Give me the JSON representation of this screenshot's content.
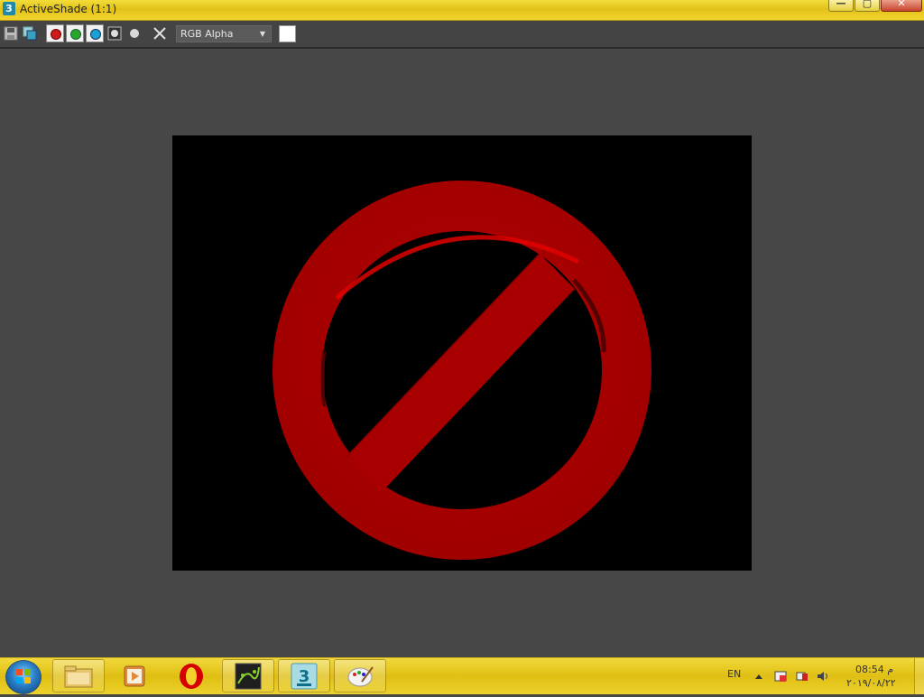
{
  "window": {
    "app_icon": "3",
    "title": "ActiveShade (1:1)",
    "controls": {
      "minimize": "—",
      "maximize": "▢",
      "close": "✕"
    }
  },
  "toolbar": {
    "icons": [
      "save-icon",
      "copy-image-icon",
      "red-channel-icon",
      "green-channel-icon",
      "blue-channel-icon",
      "alpha-channel-icon",
      "monochrome-icon",
      "clear-icon"
    ],
    "channel_select": "RGB Alpha",
    "channel_colors": {
      "red": "#cc1a1a",
      "green": "#2aa52a",
      "blue": "#1aa0d8"
    },
    "swatch_color": "#ffffff"
  },
  "render": {
    "background": "#000000",
    "symbol_color": "#a80000",
    "highlight_color": "#e00000",
    "object": "prohibition-sign"
  },
  "taskbar": {
    "start": "windows-orb-icon",
    "apps": [
      "explorer-folder-icon",
      "media-player-icon",
      "opera-icon",
      "graph-app-icon",
      "3ds-max-icon",
      "paint-icon"
    ],
    "max_badge": "3",
    "language": "EN",
    "time": "08:54 م",
    "date": "٢٠١٩/٠٨/٢٢"
  }
}
